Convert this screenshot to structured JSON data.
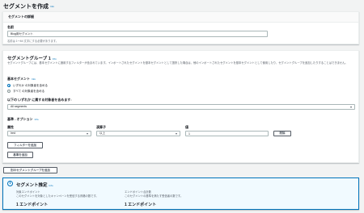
{
  "page": {
    "title": "セグメントを作成",
    "info": "Info"
  },
  "details": {
    "header": "セグメントの詳細",
    "name_label": "名前",
    "name_value": "Blog用セグメント",
    "name_hint": "名前は 1～64 文字にする必要があります。"
  },
  "group": {
    "title": "セグメントグループ 1",
    "info": "Info",
    "description": "セグメントグループには、基本セグメントに適用するフィルターが含まれています。インポートされたセグメントを基本セグメントとして選択した場合は、他のインポートされたセグメントを基本セグメントとして使用したり、セグメントグループを追加したりすることはできません。",
    "base_label": "基本セグメント",
    "base_info": "Info",
    "radio_any": "いずれか の対象者を含める",
    "radio_all": "すべて の対象者を含める",
    "select_label": "以下の いずれか に属する対象者を含めます:",
    "select_value": "All segments",
    "criteria_label": "基準 - オプション",
    "criteria_info": "Info",
    "col_attribute": "属性",
    "col_operator": "演算子",
    "col_value": "値",
    "attribute_value": "Ired",
    "operator_value": "以上",
    "value_value": "1",
    "remove_label": "削除",
    "add_filter_label": "フィルターを追加",
    "add_criteria_label": "基準を追加"
  },
  "add_group_label": "別のセグメントグループを追加",
  "estimate": {
    "title": "セグメント推定",
    "info": "Info",
    "eligible_label": "対象エンドポイント",
    "eligible_desc": "このセグメントを対象としたキャンペーンを受信する資格の数です。",
    "eligible_value": "1 エンドポイント",
    "total_label": "エンドポイント合計数",
    "total_desc": "このセグメントの基準を満たす受信者の数です。",
    "total_value": "1 エンドポイント"
  }
}
